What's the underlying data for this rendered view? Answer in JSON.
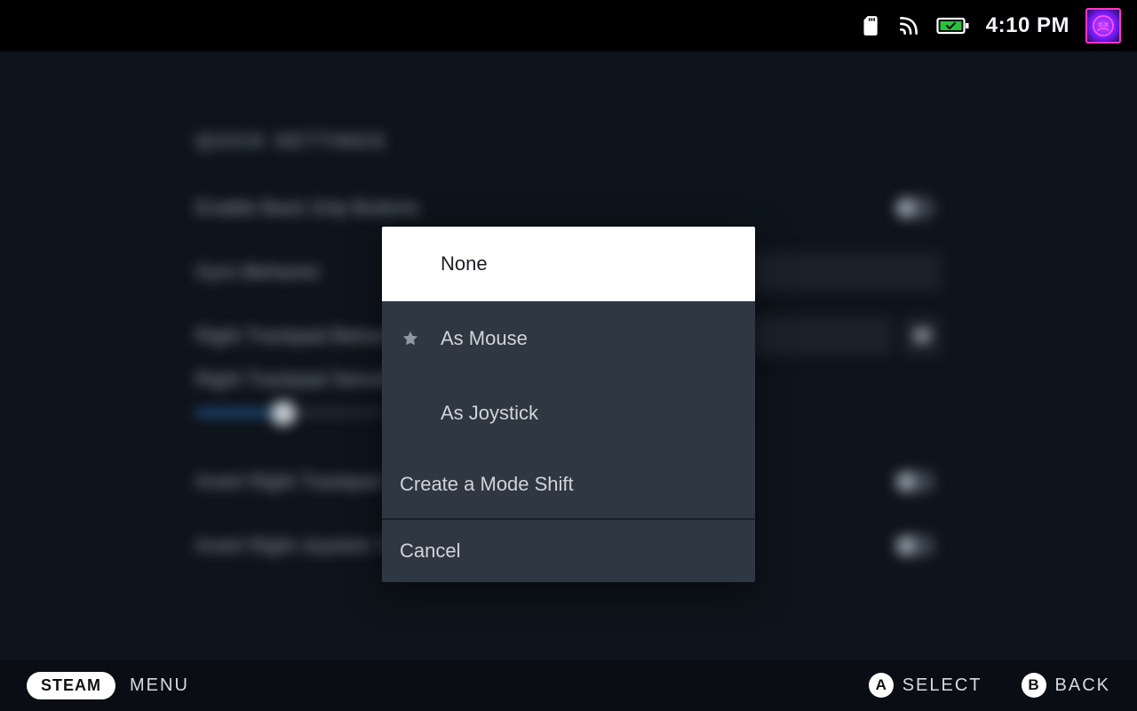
{
  "status": {
    "time": "4:10 PM"
  },
  "background": {
    "section_title": "QUICK SETTINGS",
    "rows": {
      "back_grip": "Enable Back Grip Buttons",
      "gyro": "Gyro Behavior",
      "rt_behavior": "Right Trackpad Behavior",
      "rt_sensitivity": "Right Trackpad Sensitivity",
      "invert_trackpad": "Invert Right Trackpad Y-Axis",
      "invert_joystick": "Invert Right Joystick Y-Axis"
    }
  },
  "modal": {
    "options": [
      {
        "label": "None",
        "selected": true,
        "recommended": false
      },
      {
        "label": "As Mouse",
        "selected": false,
        "recommended": true
      },
      {
        "label": "As Joystick",
        "selected": false,
        "recommended": false
      }
    ],
    "create": "Create a Mode Shift",
    "cancel": "Cancel"
  },
  "footer": {
    "steam": "STEAM",
    "menu": "MENU",
    "a_glyph": "A",
    "a_label": "SELECT",
    "b_glyph": "B",
    "b_label": "BACK"
  }
}
